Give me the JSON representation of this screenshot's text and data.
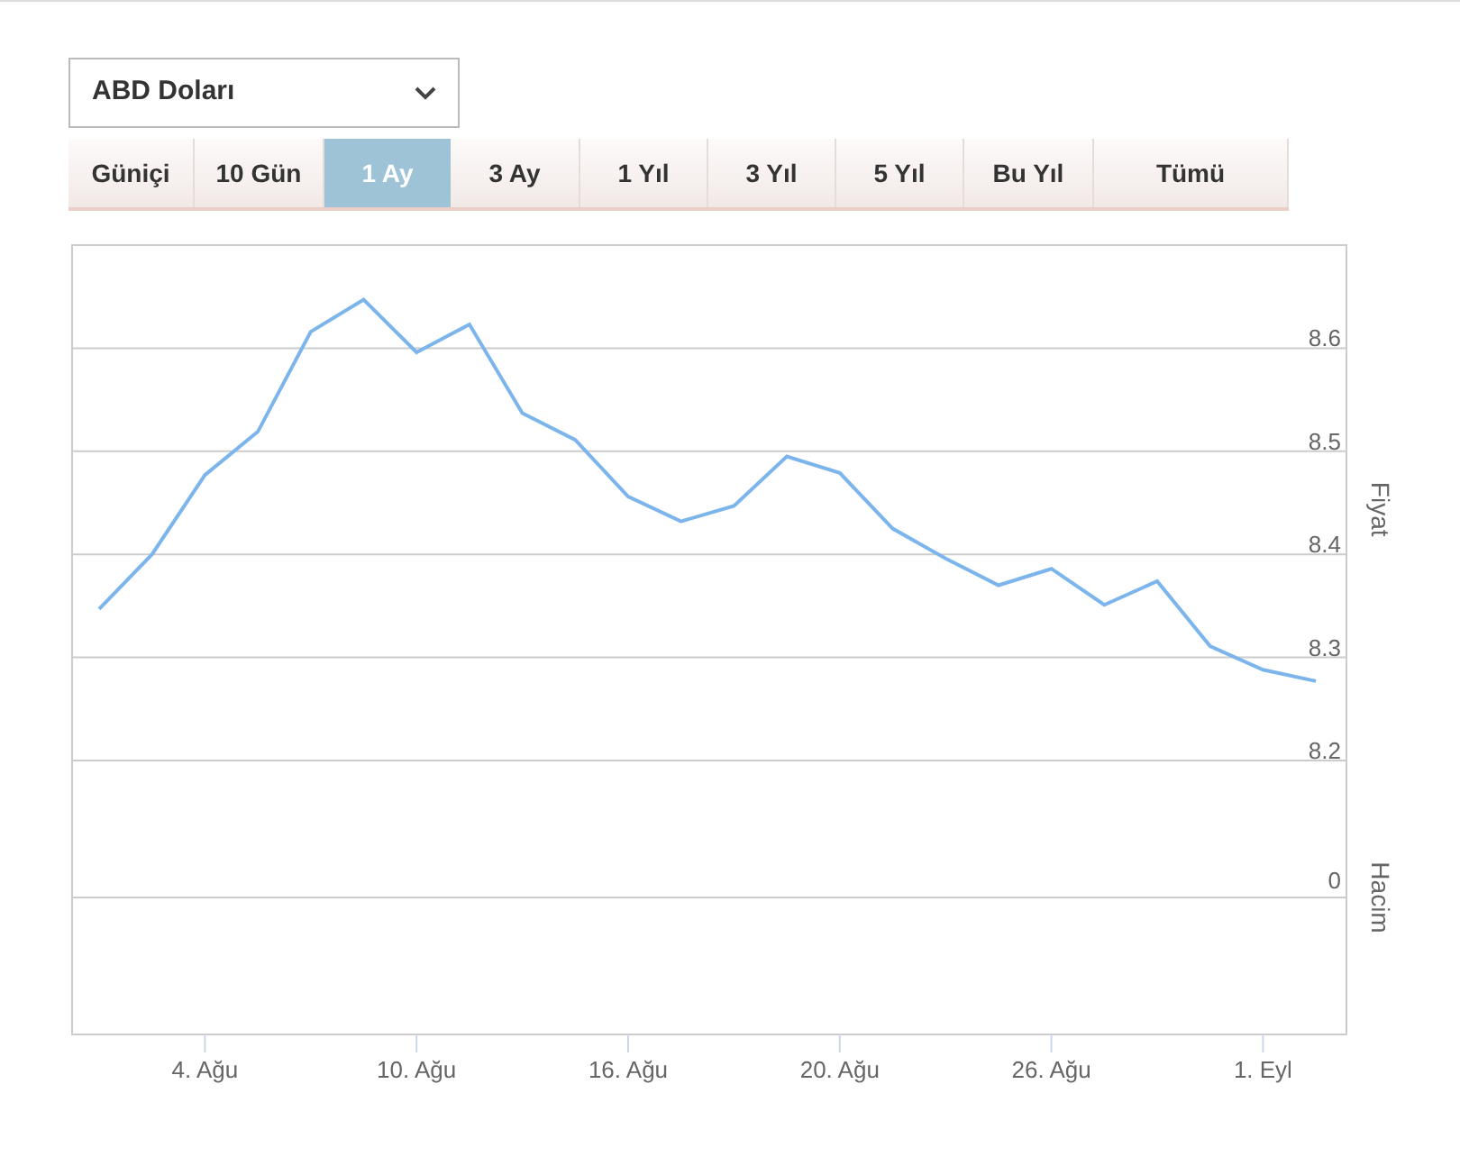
{
  "currency_select": {
    "value": "ABD Doları"
  },
  "range_tabs": [
    {
      "label": "Güniçi",
      "selected": false
    },
    {
      "label": "10 Gün",
      "selected": false
    },
    {
      "label": "1 Ay",
      "selected": true
    },
    {
      "label": "3 Ay",
      "selected": false
    },
    {
      "label": "1 Yıl",
      "selected": false
    },
    {
      "label": "3 Yıl",
      "selected": false
    },
    {
      "label": "5 Yıl",
      "selected": false
    },
    {
      "label": "Bu Yıl",
      "selected": false
    },
    {
      "label": "Tümü",
      "selected": false
    }
  ],
  "chart": {
    "volume_axis_title": "Hacim",
    "volume_ticks": [
      "0"
    ],
    "x_axis_labels": [
      "4. Ağu",
      "10. Ağu",
      "16. Ağu",
      "20. Ağu",
      "26. Ağu",
      "1. Eyl"
    ],
    "chart_data": {
      "type": "line",
      "ylabel": "Fiyat",
      "grid": true,
      "series": [
        {
          "color": "#7cb5ec",
          "values": [
            8.347,
            8.4,
            8.477,
            8.519,
            8.616,
            8.647,
            8.596,
            8.623,
            8.537,
            8.511,
            8.456,
            8.432,
            8.447,
            8.495,
            8.479,
            8.425,
            8.396,
            8.37,
            8.386,
            8.351,
            8.374,
            8.311,
            8.288,
            8.277
          ]
        }
      ],
      "yticks": [
        {
          "value": 8.2,
          "label": "8.2"
        },
        {
          "value": 8.3,
          "label": "8.3"
        },
        {
          "value": 8.4,
          "label": "8.4"
        },
        {
          "value": 8.5,
          "label": "8.5"
        },
        {
          "value": 8.6,
          "label": "8.6"
        }
      ],
      "ylim": [
        8.2,
        8.7
      ]
    }
  }
}
